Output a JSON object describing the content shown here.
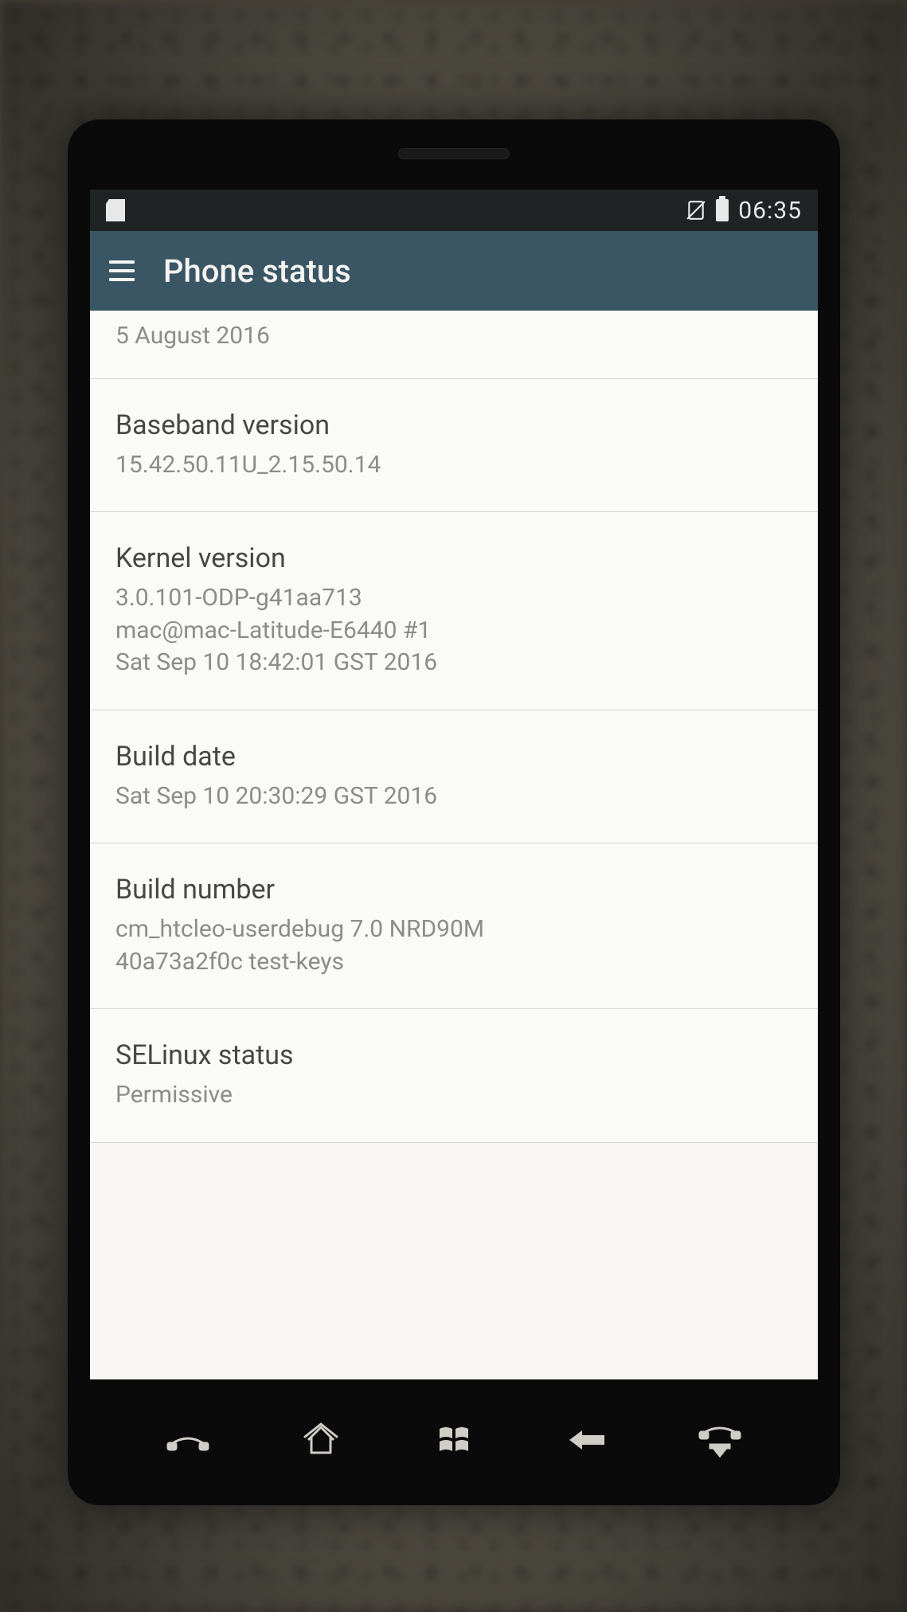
{
  "statusbar": {
    "time": "06:35",
    "icons": {
      "sdcard": "sd-card-icon",
      "nosim": "no-sim-icon",
      "battery": "battery-full-icon"
    }
  },
  "appbar": {
    "title": "Phone status",
    "menu_icon": "hamburger-icon"
  },
  "settings": {
    "partial_top_value": "5 August 2016",
    "items": [
      {
        "title": "Baseband version",
        "value": "15.42.50.11U_2.15.50.14"
      },
      {
        "title": "Kernel version",
        "value": "3.0.101-ODP-g41aa713\nmac@mac-Latitude-E6440 #1\nSat Sep 10 18:42:01 GST 2016"
      },
      {
        "title": "Build date",
        "value": "Sat Sep 10 20:30:29 GST 2016"
      },
      {
        "title": "Build number",
        "value": "cm_htcleo-userdebug 7.0 NRD90M\n40a73a2f0c test-keys"
      },
      {
        "title": "SELinux status",
        "value": "Permissive"
      }
    ]
  },
  "hardware_buttons": {
    "call": "call-icon",
    "home": "home-icon",
    "windows": "windows-icon",
    "back": "back-arrow-icon",
    "endcall": "end-call-icon"
  }
}
